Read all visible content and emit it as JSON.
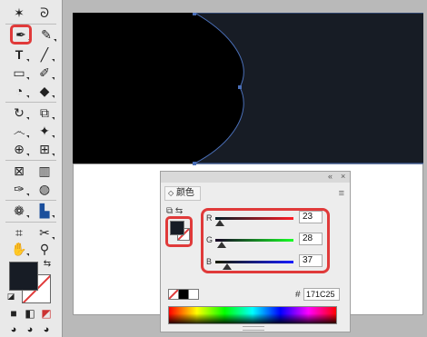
{
  "toolbar": {
    "tools": [
      {
        "name": "magic-wand-icon",
        "glyph": "✶"
      },
      {
        "name": "lasso-icon",
        "glyph": "ᘐ"
      },
      {
        "name": "pen-tool-icon",
        "glyph": "✒"
      },
      {
        "name": "curvature-tool-icon",
        "glyph": "✎"
      },
      {
        "name": "type-tool-icon",
        "glyph": "T"
      },
      {
        "name": "line-tool-icon",
        "glyph": "╱"
      },
      {
        "name": "rectangle-tool-icon",
        "glyph": "▭"
      },
      {
        "name": "paintbrush-tool-icon",
        "glyph": "✐"
      },
      {
        "name": "shaper-tool-icon",
        "glyph": "◔"
      },
      {
        "name": "eraser-tool-icon",
        "glyph": "◆"
      },
      {
        "name": "rotate-tool-icon",
        "glyph": "↻"
      },
      {
        "name": "scale-tool-icon",
        "glyph": "⧉"
      },
      {
        "name": "warp-tool-icon",
        "glyph": "෴"
      },
      {
        "name": "puppet-warp-tool-icon",
        "glyph": "✦"
      },
      {
        "name": "shape-builder-tool-icon",
        "glyph": "⊕"
      },
      {
        "name": "perspective-grid-tool-icon",
        "glyph": "⊞"
      },
      {
        "name": "mesh-tool-icon",
        "glyph": "⊠"
      },
      {
        "name": "gradient-tool-icon",
        "glyph": "▥"
      },
      {
        "name": "eyedropper-tool-icon",
        "glyph": "✑"
      },
      {
        "name": "blend-tool-icon",
        "glyph": "◍"
      },
      {
        "name": "symbol-sprayer-tool-icon",
        "glyph": "❁"
      },
      {
        "name": "column-graph-tool-icon",
        "glyph": "▙"
      },
      {
        "name": "artboard-tool-icon",
        "glyph": "⌗"
      },
      {
        "name": "slice-tool-icon",
        "glyph": "✂"
      },
      {
        "name": "hand-tool-icon",
        "glyph": "✋"
      },
      {
        "name": "zoom-tool-icon",
        "glyph": "⚲"
      }
    ],
    "swap_glyph": "⇆",
    "default_glyph": "◪",
    "bottom_modes": [
      "■",
      "◧",
      "◩"
    ],
    "draw_modes": [
      "◕",
      "◕",
      "◕"
    ]
  },
  "panel": {
    "collapse_glyph": "«",
    "close_glyph": "×",
    "tab_arrow": "◇",
    "tab_label": "颜色",
    "menu_glyph": "≡",
    "mini_icons": "⧉ ⇆",
    "channels": [
      {
        "label": "R",
        "value": "23"
      },
      {
        "label": "G",
        "value": "28"
      },
      {
        "label": "B",
        "value": "37"
      }
    ],
    "hex_label": "#",
    "hex_value": "171C25"
  },
  "colors": {
    "current_fill": "#171c25",
    "highlight": "#e03a3a"
  }
}
